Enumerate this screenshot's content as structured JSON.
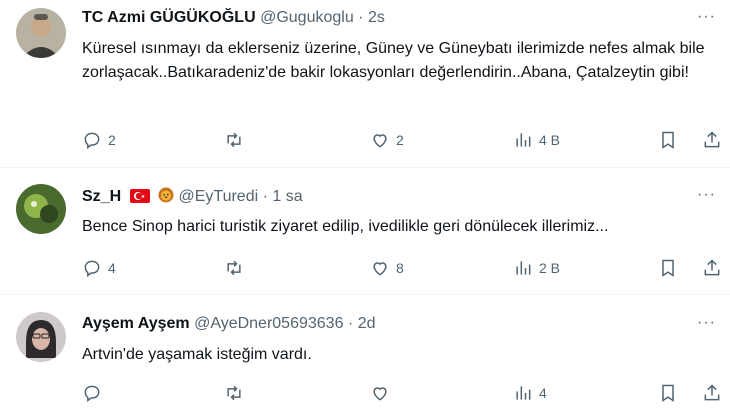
{
  "tweets": [
    {
      "name": "TC Azmi GÜGÜKOĞLU",
      "handle": "@Gugukoglu",
      "dot": "·",
      "time": "2s",
      "text": "Küresel ısınmayı da eklerseniz üzerine, Güney ve Güneybatı ilerimizde nefes almak bile zorlaşacak..Batıkaradeniz'de bakir lokasyonları değerlendirin..Abana, Çatalzeytin gibi!",
      "replies": "2",
      "retweets": "",
      "likes": "2",
      "views": "4 B",
      "avatar_colors": [
        "#8a8f7e",
        "#c9b9a0"
      ]
    },
    {
      "name": "Sz_H",
      "handle": "@EyTuredi",
      "dot": "·",
      "time": "1 sa",
      "text": "Bence Sinop harici turistik ziyaret edilip, ivedilikle geri dönülecek illerimiz...",
      "replies": "4",
      "retweets": "",
      "likes": "8",
      "views": "2 B",
      "badges": [
        "turkish-flag",
        "lion-emoji"
      ],
      "avatar_colors": [
        "#3d5a2a",
        "#9bbf5a"
      ]
    },
    {
      "name": "Ayşem Ayşem",
      "handle": "@AyeDner05693636",
      "dot": "·",
      "time": "2d",
      "text": "Artvin'de yaşamak isteğim vardı.",
      "replies": "",
      "retweets": "",
      "likes": "",
      "views": "4",
      "avatar_colors": [
        "#6e6a6e",
        "#d9d4d6"
      ]
    }
  ],
  "more_icon": "···",
  "colors": {
    "muted": "#536471",
    "text": "#0f1419",
    "divider": "#eff3f4",
    "flag_red": "#e30a17"
  },
  "icons": [
    "reply-icon",
    "retweet-icon",
    "like-icon",
    "views-icon",
    "bookmark-icon",
    "share-icon",
    "more-icon"
  ]
}
